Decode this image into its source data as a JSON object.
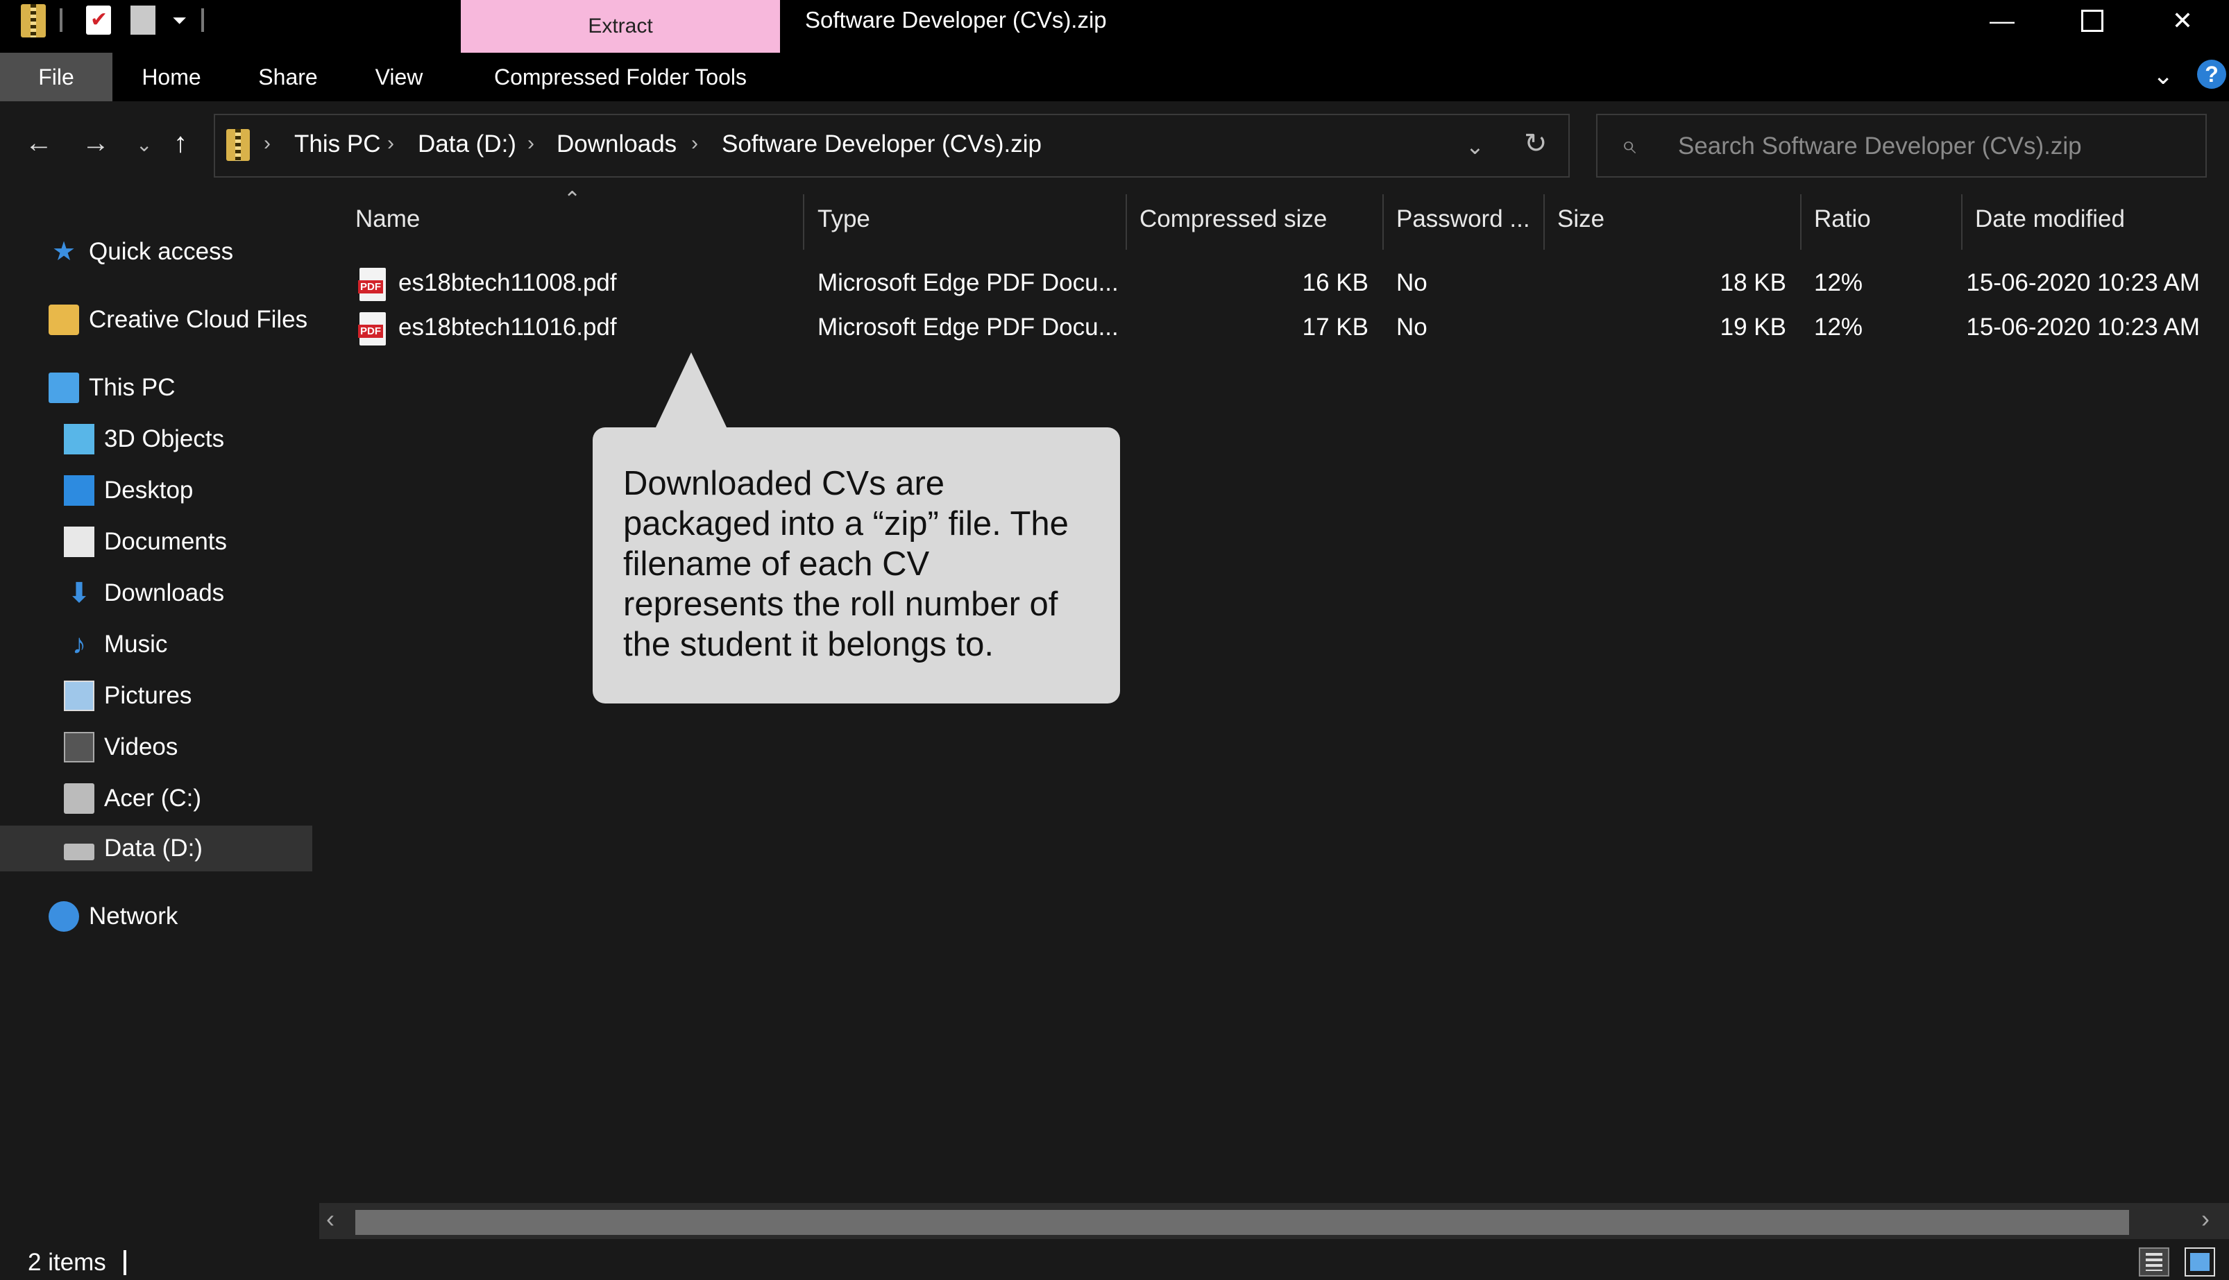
{
  "window": {
    "title": "Software Developer (CVs).zip",
    "extract_tab_label": "Extract",
    "minimize_glyph": "—",
    "close_glyph": "✕"
  },
  "ribbon": {
    "tabs": [
      "File",
      "Home",
      "Share",
      "View",
      "Compressed Folder Tools"
    ]
  },
  "breadcrumb": [
    "This PC",
    "Data (D:)",
    "Downloads",
    "Software Developer (CVs).zip"
  ],
  "search": {
    "placeholder": "Search Software Developer (CVs).zip"
  },
  "sidebar": {
    "items": [
      {
        "label": "Quick access",
        "icon": "star-icon"
      },
      {
        "label": "Creative Cloud Files",
        "icon": "creative-cloud-icon"
      },
      {
        "label": "This PC",
        "icon": "computer-icon"
      },
      {
        "label": "3D Objects",
        "icon": "cube-icon"
      },
      {
        "label": "Desktop",
        "icon": "desktop-icon"
      },
      {
        "label": "Documents",
        "icon": "document-icon"
      },
      {
        "label": "Downloads",
        "icon": "download-arrow-icon"
      },
      {
        "label": "Music",
        "icon": "music-note-icon"
      },
      {
        "label": "Pictures",
        "icon": "picture-icon"
      },
      {
        "label": "Videos",
        "icon": "film-icon"
      },
      {
        "label": "Acer (C:)",
        "icon": "windows-drive-icon"
      },
      {
        "label": "Data (D:)",
        "icon": "drive-icon"
      },
      {
        "label": "Network",
        "icon": "network-icon"
      }
    ],
    "selected": "Data (D:)"
  },
  "table": {
    "columns": [
      "Name",
      "Type",
      "Compressed size",
      "Password ...",
      "Size",
      "Ratio",
      "Date modified"
    ],
    "sort_column": "Name",
    "rows": [
      {
        "name": "es18btech11008.pdf",
        "type": "Microsoft Edge PDF Docu...",
        "compressed": "16 KB",
        "password": "No",
        "size": "18 KB",
        "ratio": "12%",
        "date": "15-06-2020 10:23 AM"
      },
      {
        "name": "es18btech11016.pdf",
        "type": "Microsoft Edge PDF Docu...",
        "compressed": "17 KB",
        "password": "No",
        "size": "19 KB",
        "ratio": "12%",
        "date": "15-06-2020 10:23 AM"
      }
    ]
  },
  "callout": {
    "text": "Downloaded CVs are packaged into a “zip” file. The filename of each CV represents the roll number of the student it belongs to."
  },
  "status": {
    "item_count": "2 items"
  },
  "colors": {
    "background": "#191919",
    "extract_tab": "#f7b8dc",
    "selected_nav": "#333333",
    "callout": "#d9d9d9"
  }
}
